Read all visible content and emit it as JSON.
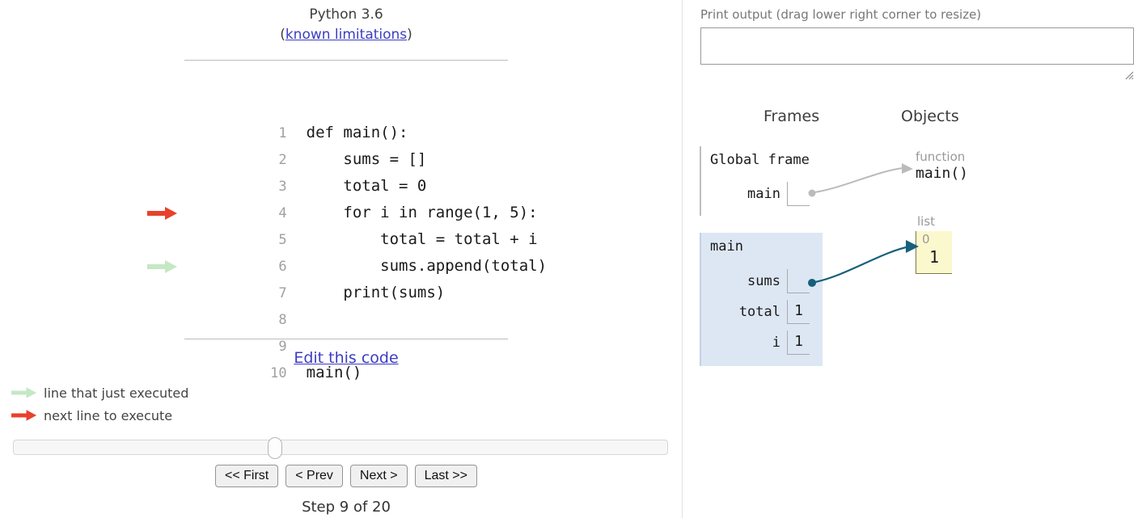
{
  "left": {
    "header": {
      "python_version": "Python 3.6",
      "limitations_prefix": "(",
      "limitations_link": "known limitations",
      "limitations_suffix": ")"
    },
    "code": {
      "lines": [
        {
          "num": "1",
          "text": "def main():",
          "arrow": "none"
        },
        {
          "num": "2",
          "text": "    sums = []",
          "arrow": "none"
        },
        {
          "num": "3",
          "text": "    total = 0",
          "arrow": "none"
        },
        {
          "num": "4",
          "text": "    for i in range(1, 5):",
          "arrow": "red"
        },
        {
          "num": "5",
          "text": "        total = total + i",
          "arrow": "none"
        },
        {
          "num": "6",
          "text": "        sums.append(total)",
          "arrow": "green"
        },
        {
          "num": "7",
          "text": "    print(sums)",
          "arrow": "none"
        },
        {
          "num": "8",
          "text": "",
          "arrow": "none"
        },
        {
          "num": "9",
          "text": "",
          "arrow": "none"
        },
        {
          "num": "10",
          "text": "main()",
          "arrow": "none"
        }
      ]
    },
    "edit_link": "Edit this code",
    "legend": [
      {
        "arrow": "green",
        "label": "line that just executed"
      },
      {
        "arrow": "red",
        "label": "next line to execute"
      }
    ],
    "controls": {
      "first_label": "<< First",
      "prev_label": "< Prev",
      "next_label": "Next >",
      "last_label": "Last >>",
      "step_label": "Step 9 of 20",
      "slider_position_percent": 39
    }
  },
  "right": {
    "print_output": {
      "label": "Print output (drag lower right corner to resize)",
      "value": ""
    },
    "headings": {
      "frames": "Frames",
      "objects": "Objects"
    },
    "frames": [
      {
        "title": "Global frame",
        "highlighted": false,
        "vars": [
          {
            "name": "main",
            "value": "",
            "is_pointer": true
          }
        ]
      },
      {
        "title": "main",
        "highlighted": true,
        "vars": [
          {
            "name": "sums",
            "value": "",
            "is_pointer": true
          },
          {
            "name": "total",
            "value": "1",
            "is_pointer": false
          },
          {
            "name": "i",
            "value": "1",
            "is_pointer": false
          }
        ]
      }
    ],
    "objects": [
      {
        "type": "function",
        "name": "main()"
      },
      {
        "type": "list",
        "indices": [
          "0"
        ],
        "values": [
          "1"
        ]
      }
    ]
  },
  "colors": {
    "red_arrow": "#e8412c",
    "green_arrow": "#c4e8c4",
    "link_blue": "#3c3cc4",
    "frame_highlight": "#dde7f4",
    "list_yellow": "#fcf8ce",
    "pointer_arrow": "#15607a",
    "function_arrow": "#bbbbbb"
  }
}
